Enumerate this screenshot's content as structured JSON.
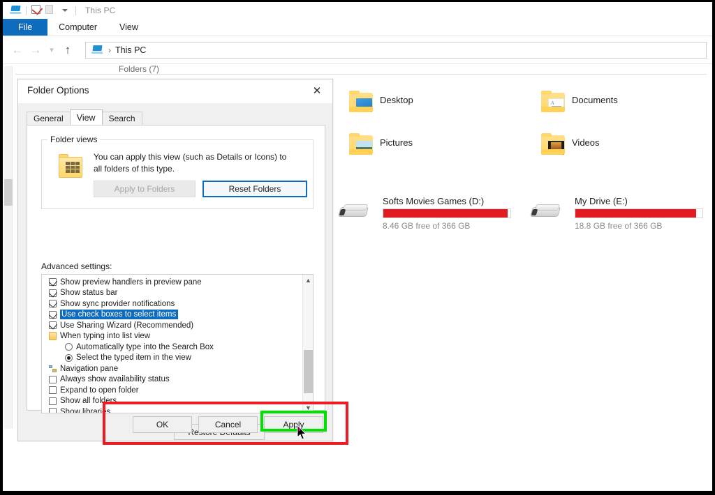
{
  "window": {
    "quick_access": {
      "pc_icon": "this-pc-icon",
      "properties_icon": "properties-checkbox-icon",
      "new_folder_icon": "new-folder-icon",
      "customize_icon": "chevron-down-icon"
    },
    "title": "This PC",
    "ribbon_tabs": [
      {
        "label": "File",
        "selected": true
      },
      {
        "label": "Computer",
        "selected": false
      },
      {
        "label": "View",
        "selected": false
      }
    ],
    "nav": {
      "back_icon": "back-arrow-icon",
      "forward_icon": "forward-arrow-icon",
      "recent_icon": "recent-locations-icon",
      "up_icon": "up-arrow-icon"
    },
    "address": {
      "root_icon": "this-pc-icon",
      "separator": "›",
      "crumb": "This PC"
    }
  },
  "content": {
    "folders_group": "Folders (7)",
    "folders": [
      {
        "label": "Desktop",
        "icon": "folder-desktop-icon"
      },
      {
        "label": "Documents",
        "icon": "folder-documents-icon"
      },
      {
        "label": "Pictures",
        "icon": "folder-pictures-icon"
      },
      {
        "label": "Videos",
        "icon": "folder-videos-icon"
      }
    ],
    "drives": [
      {
        "name": "Softs Movies Games (D:)",
        "free_text": "8.46 GB free of 366 GB",
        "used_percent": 97.7,
        "bar_color": "#e01b22",
        "icon": "hard-drive-icon"
      },
      {
        "name": "My Drive (E:)",
        "free_text": "18.8 GB free of 366 GB",
        "used_percent": 94.9,
        "bar_color": "#e01b22",
        "icon": "hard-drive-icon"
      }
    ]
  },
  "dialog": {
    "title": "Folder Options",
    "close_icon": "close-icon",
    "tabs": [
      {
        "label": "General",
        "selected": false
      },
      {
        "label": "View",
        "selected": true
      },
      {
        "label": "Search",
        "selected": false
      }
    ],
    "folder_views": {
      "legend": "Folder views",
      "icon": "folder-view-icon",
      "description": "You can apply this view (such as Details or Icons) to all folders of this type.",
      "apply_to_folders": {
        "label": "Apply to Folders",
        "disabled": true
      },
      "reset_folders": {
        "label": "Reset Folders",
        "focused": true
      }
    },
    "advanced_label": "Advanced settings:",
    "advanced_rows": [
      {
        "type": "checkbox",
        "checked": true,
        "label": "Show preview handlers in preview pane",
        "selected": false
      },
      {
        "type": "checkbox",
        "checked": true,
        "label": "Show status bar",
        "selected": false
      },
      {
        "type": "checkbox",
        "checked": true,
        "label": "Show sync provider notifications",
        "selected": false
      },
      {
        "type": "checkbox",
        "checked": true,
        "label": "Use check boxes to select items",
        "selected": true
      },
      {
        "type": "checkbox",
        "checked": true,
        "label": "Use Sharing Wizard (Recommended)",
        "selected": false
      },
      {
        "type": "category",
        "icon": "typing-category-icon",
        "label": "When typing into list view",
        "selected": false
      },
      {
        "type": "radio",
        "checked": false,
        "label": "Automatically type into the Search Box",
        "selected": false
      },
      {
        "type": "radio",
        "checked": true,
        "label": "Select the typed item in the view",
        "selected": false
      },
      {
        "type": "category",
        "icon": "navigation-pane-category-icon",
        "label": "Navigation pane",
        "selected": false
      },
      {
        "type": "checkbox",
        "checked": false,
        "label": "Always show availability status",
        "selected": false
      },
      {
        "type": "checkbox",
        "checked": false,
        "label": "Expand to open folder",
        "selected": false
      },
      {
        "type": "checkbox",
        "checked": false,
        "label": "Show all folders",
        "selected": false
      },
      {
        "type": "checkbox",
        "checked": false,
        "label": "Show libraries",
        "selected": false
      }
    ],
    "scroll_up_icon": "scroll-up-icon",
    "scroll_down_icon": "scroll-down-icon",
    "restore_defaults": "Restore Defaults",
    "footer": {
      "ok": "OK",
      "cancel": "Cancel",
      "apply": "Apply"
    }
  },
  "annotations": {
    "highlight_box_color": "#ed1c24",
    "focus_box_color": "#00e100",
    "cursor_icon": "mouse-pointer-icon"
  }
}
